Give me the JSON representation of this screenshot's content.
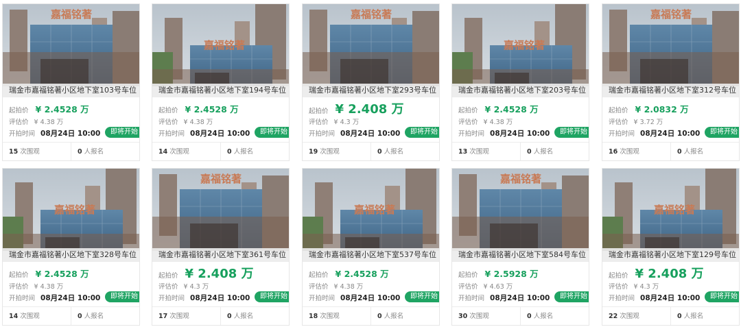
{
  "listings": [
    {
      "title": "瑞金市嘉福铭著小区地下室103号车位",
      "start_label": "起拍价",
      "start_price": "¥ 2.4528 万",
      "eval_label": "评估价",
      "eval_price": "¥ 4.38 万",
      "time_label": "开拍时间",
      "time": "08月24日 10:00",
      "status": "即将开始",
      "views": "15",
      "views_label": "次围观",
      "signups": "0",
      "signups_label": "人报名",
      "sign_text": "嘉福铭著"
    },
    {
      "title": "瑞金市嘉福铭著小区地下室194号车位",
      "start_label": "起拍价",
      "start_price": "¥ 2.4528 万",
      "eval_label": "评估价",
      "eval_price": "¥ 4.38 万",
      "time_label": "开拍时间",
      "time": "08月24日 10:00",
      "status": "即将开始",
      "views": "14",
      "views_label": "次围观",
      "signups": "0",
      "signups_label": "人报名",
      "sign_text": "嘉福铭著"
    },
    {
      "title": "瑞金市嘉福铭著小区地下室293号车位",
      "start_label": "起拍价",
      "start_price": "¥ 2.408 万",
      "eval_label": "评估价",
      "eval_price": "¥ 4.3 万",
      "time_label": "开拍时间",
      "time": "08月24日 10:00",
      "status": "即将开始",
      "views": "19",
      "views_label": "次围观",
      "signups": "0",
      "signups_label": "人报名",
      "sign_text": "嘉福铭著"
    },
    {
      "title": "瑞金市嘉福铭著小区地下室203号车位",
      "start_label": "起拍价",
      "start_price": "¥ 2.4528 万",
      "eval_label": "评估价",
      "eval_price": "¥ 4.38 万",
      "time_label": "开拍时间",
      "time": "08月24日 10:00",
      "status": "即将开始",
      "views": "13",
      "views_label": "次围观",
      "signups": "0",
      "signups_label": "人报名",
      "sign_text": "嘉福铭著"
    },
    {
      "title": "瑞金市嘉福铭著小区地下室312号车位",
      "start_label": "起拍价",
      "start_price": "¥ 2.0832 万",
      "eval_label": "评估价",
      "eval_price": "¥ 3.72 万",
      "time_label": "开拍时间",
      "time": "08月24日 10:00",
      "status": "即将开始",
      "views": "16",
      "views_label": "次围观",
      "signups": "0",
      "signups_label": "人报名",
      "sign_text": "嘉福铭著"
    },
    {
      "title": "瑞金市嘉福铭著小区地下室328号车位",
      "start_label": "起拍价",
      "start_price": "¥ 2.4528 万",
      "eval_label": "评估价",
      "eval_price": "¥ 4.38 万",
      "time_label": "开拍时间",
      "time": "08月24日 10:00",
      "status": "即将开始",
      "views": "14",
      "views_label": "次围观",
      "signups": "0",
      "signups_label": "人报名",
      "sign_text": "嘉福铭著"
    },
    {
      "title": "瑞金市嘉福铭著小区地下室361号车位",
      "start_label": "起拍价",
      "start_price": "¥ 2.408 万",
      "eval_label": "评估价",
      "eval_price": "¥ 4.3 万",
      "time_label": "开拍时间",
      "time": "08月24日 10:00",
      "status": "即将开始",
      "views": "17",
      "views_label": "次围观",
      "signups": "0",
      "signups_label": "人报名",
      "sign_text": "嘉福铭著"
    },
    {
      "title": "瑞金市嘉福铭著小区地下室537号车位",
      "start_label": "起拍价",
      "start_price": "¥ 2.4528 万",
      "eval_label": "评估价",
      "eval_price": "¥ 4.38 万",
      "time_label": "开拍时间",
      "time": "08月24日 10:00",
      "status": "即将开始",
      "views": "18",
      "views_label": "次围观",
      "signups": "0",
      "signups_label": "人报名",
      "sign_text": "嘉福铭著"
    },
    {
      "title": "瑞金市嘉福铭著小区地下室584号车位",
      "start_label": "起拍价",
      "start_price": "¥ 2.5928 万",
      "eval_label": "评估价",
      "eval_price": "¥ 4.63 万",
      "time_label": "开拍时间",
      "time": "08月24日 10:00",
      "status": "即将开始",
      "views": "30",
      "views_label": "次围观",
      "signups": "0",
      "signups_label": "人报名",
      "sign_text": "嘉福铭著"
    },
    {
      "title": "瑞金市嘉福铭著小区地下室129号车位",
      "start_label": "起拍价",
      "start_price": "¥ 2.408 万",
      "eval_label": "评估价",
      "eval_price": "¥ 4.3 万",
      "time_label": "开拍时间",
      "time": "08月24日 10:00",
      "status": "即将开始",
      "views": "22",
      "views_label": "次围观",
      "signups": "0",
      "signups_label": "人报名",
      "sign_text": "嘉福铭著"
    }
  ],
  "colors": {
    "accent": "#17a05d",
    "badge": "#1fa463"
  }
}
